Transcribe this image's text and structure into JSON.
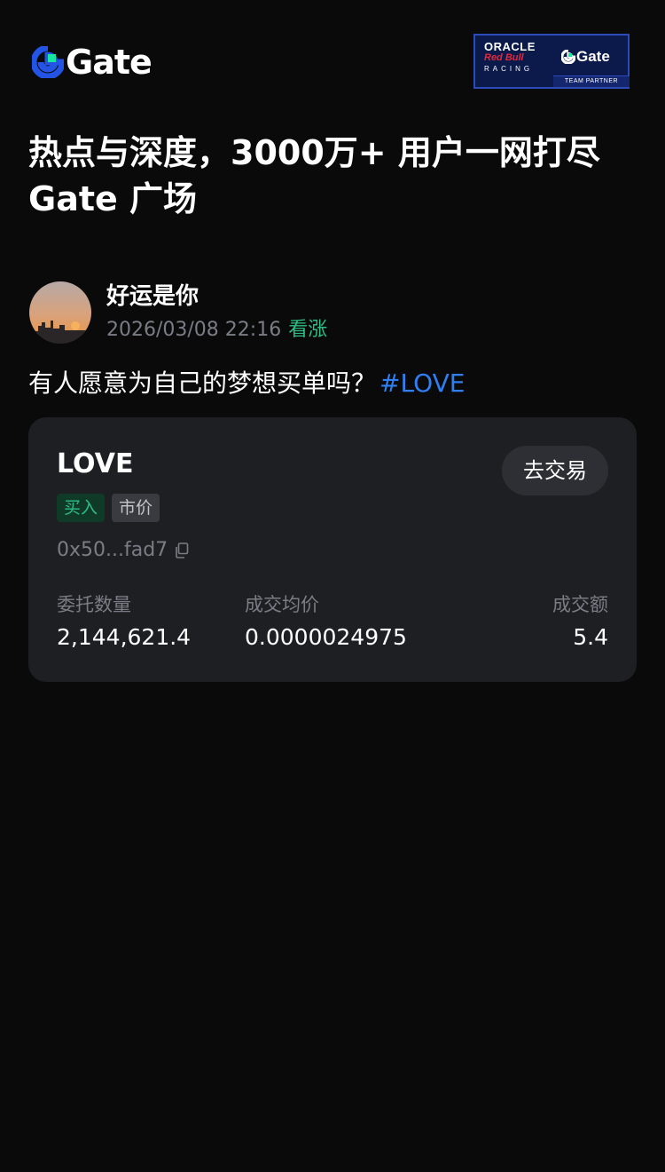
{
  "brand": {
    "logo_text": "Gate",
    "accent_colors": {
      "logo_blue": "#2354e6",
      "logo_green": "#17e6a1"
    }
  },
  "partner_badge": {
    "line1": "ORACLE",
    "line2": "Red Bull",
    "line3": "RACING",
    "brand": "Gate",
    "strip": "TEAM PARTNER"
  },
  "headline": {
    "line1": "热点与深度，3000万+ 用户一网打尽",
    "line2": "Gate 广场"
  },
  "post": {
    "author": "好运是你",
    "timestamp": "2026/03/08 22:16",
    "sentiment": "看涨",
    "text": "有人愿意为自己的梦想买单吗？",
    "hashtag": "#LOVE",
    "avatar_icon": "sunset-avatar"
  },
  "trade_card": {
    "token": "LOVE",
    "action_button": "去交易",
    "side_tag": "买入",
    "type_tag": "市价",
    "address": "0x50...fad7",
    "stats": [
      {
        "label": "委托数量",
        "value": "2,144,621.4"
      },
      {
        "label": "成交均价",
        "value": "0.0000024975"
      },
      {
        "label": "成交额",
        "value": "5.4"
      }
    ]
  },
  "colors": {
    "background": "#0a0a0b",
    "card": "#1e1f23",
    "bullish_green": "#2ebd85",
    "hashtag_blue": "#2f7ff2",
    "muted_text": "#7a7d85"
  }
}
